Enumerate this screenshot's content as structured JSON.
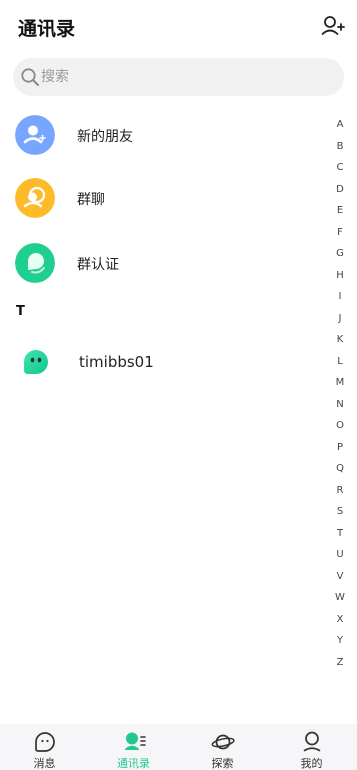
{
  "header": {
    "title": "通讯录",
    "add_icon": "add-contact-icon"
  },
  "search": {
    "placeholder": "搜索",
    "icon": "search-icon"
  },
  "entries": [
    {
      "label": "新的朋友",
      "icon": "new-friend-icon",
      "color": "#76a6ff"
    },
    {
      "label": "群聊",
      "icon": "group-chat-icon",
      "color": "#fdbb2a"
    },
    {
      "label": "群认证",
      "icon": "group-verify-icon",
      "color": "#20cf90"
    }
  ],
  "sections": [
    {
      "letter": "T",
      "contacts": [
        {
          "name": "timibbs01",
          "avatar": "bot-avatar",
          "color": "#22d39a"
        }
      ]
    }
  ],
  "index_letters": [
    "A",
    "B",
    "C",
    "D",
    "E",
    "F",
    "G",
    "H",
    "I",
    "J",
    "K",
    "L",
    "M",
    "N",
    "O",
    "P",
    "Q",
    "R",
    "S",
    "T",
    "U",
    "V",
    "W",
    "X",
    "Y",
    "Z"
  ],
  "tabs": [
    {
      "label": "消息",
      "icon": "chat-bubble-icon",
      "active": false
    },
    {
      "label": "通讯录",
      "icon": "contacts-icon",
      "active": true
    },
    {
      "label": "探索",
      "icon": "planet-icon",
      "active": false
    },
    {
      "label": "我的",
      "icon": "profile-icon",
      "active": false
    }
  ],
  "colors": {
    "accent": "#21c890",
    "search_bg": "#f1f1f1",
    "tabbar_bg": "#f6f6f8"
  }
}
